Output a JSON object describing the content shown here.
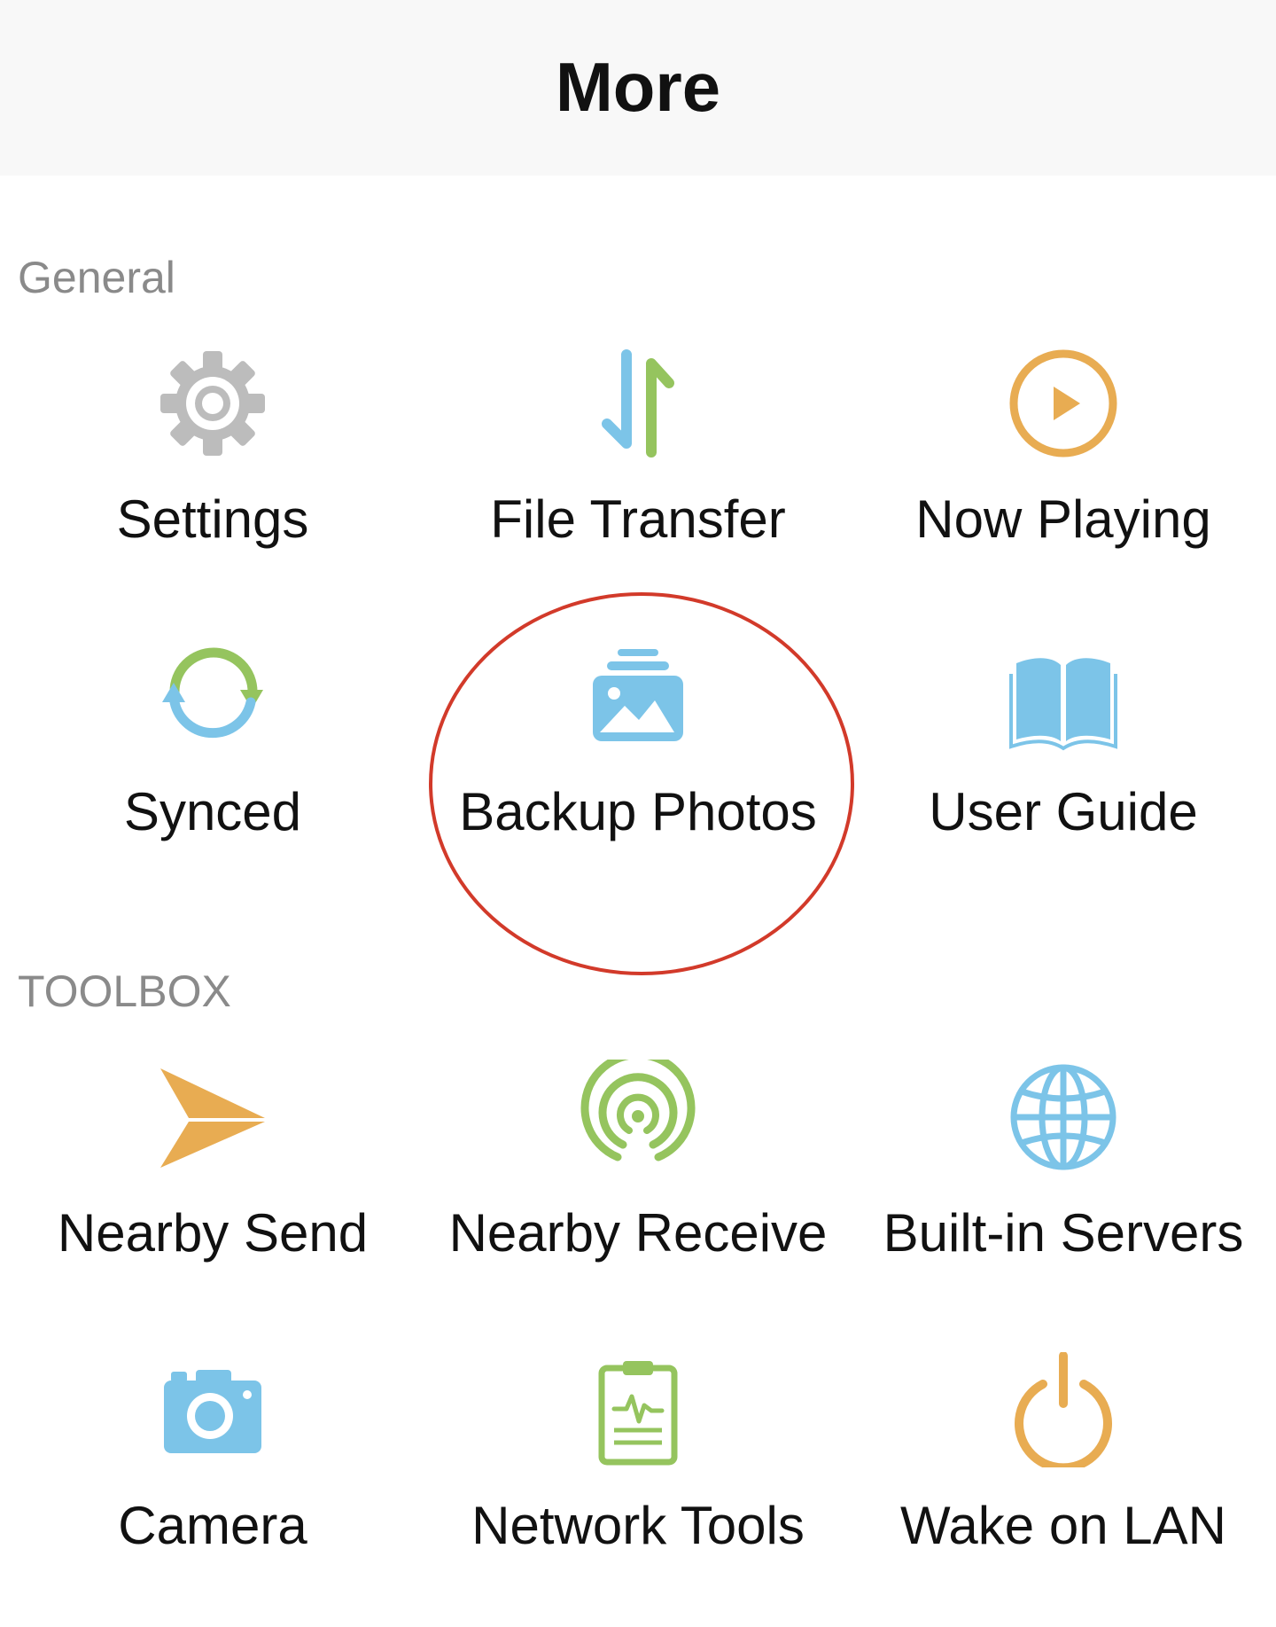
{
  "header": {
    "title": "More"
  },
  "sections": {
    "general": {
      "title": "General"
    },
    "toolbox": {
      "title": "TOOLBOX"
    }
  },
  "general_items": [
    {
      "label": "Settings",
      "icon": "gear-icon"
    },
    {
      "label": "File Transfer",
      "icon": "transfer-arrows-icon"
    },
    {
      "label": "Now Playing",
      "icon": "play-circle-icon"
    },
    {
      "label": "Synced",
      "icon": "sync-icon"
    },
    {
      "label": "Backup Photos",
      "icon": "photo-stack-icon"
    },
    {
      "label": "User Guide",
      "icon": "open-book-icon"
    }
  ],
  "toolbox_items": [
    {
      "label": "Nearby Send",
      "icon": "paper-plane-icon"
    },
    {
      "label": "Nearby Receive",
      "icon": "signal-receive-icon"
    },
    {
      "label": "Built-in Servers",
      "icon": "globe-icon"
    },
    {
      "label": "Camera",
      "icon": "camera-icon"
    },
    {
      "label": "Network Tools",
      "icon": "clipboard-pulse-icon"
    },
    {
      "label": "Wake on LAN",
      "icon": "power-icon"
    }
  ],
  "colors": {
    "gray": "#bcbcbc",
    "blue": "#7cc4e8",
    "green": "#95c45e",
    "orange": "#e8ac52",
    "highlight": "#d23a2a",
    "header_bg": "#f8f8f8"
  }
}
